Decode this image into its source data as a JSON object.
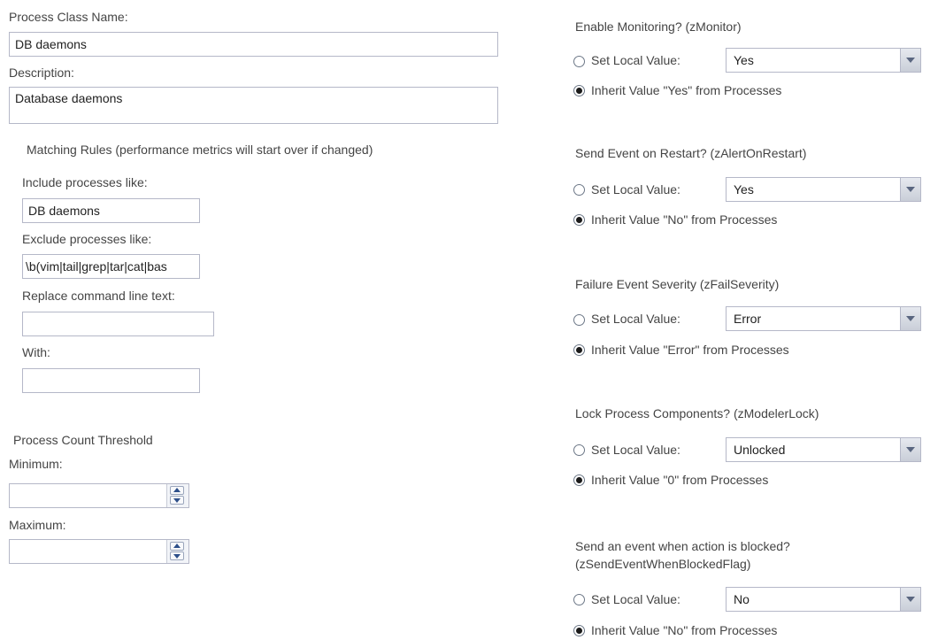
{
  "left": {
    "class_name_label": "Process Class Name:",
    "class_name_value": "DB daemons",
    "description_label": "Description:",
    "description_value": "Database daemons",
    "matching_header": "Matching Rules (performance metrics will start over if changed)",
    "include_label": "Include processes like:",
    "include_value": "DB daemons",
    "exclude_label": "Exclude processes like:",
    "exclude_value": "\\b(vim|tail|grep|tar|cat|bas",
    "replace_label": "Replace command line text:",
    "replace_value": "",
    "with_label": "With:",
    "with_value": "",
    "threshold_header": "Process Count Threshold",
    "minimum_label": "Minimum:",
    "minimum_value": "",
    "maximum_label": "Maximum:",
    "maximum_value": ""
  },
  "right": {
    "set_local_label": "Set Local Value:",
    "sections": [
      {
        "title": "Enable Monitoring? (zMonitor)",
        "local_value": "Yes",
        "inherit_text": "Inherit Value \"Yes\" from Processes",
        "mode": "inherit"
      },
      {
        "title": "Send Event on Restart? (zAlertOnRestart)",
        "local_value": "Yes",
        "inherit_text": "Inherit Value \"No\" from Processes",
        "mode": "inherit"
      },
      {
        "title": "Failure Event Severity (zFailSeverity)",
        "local_value": "Error",
        "inherit_text": "Inherit Value \"Error\" from Processes",
        "mode": "inherit"
      },
      {
        "title": "Lock Process Components? (zModelerLock)",
        "local_value": "Unlocked",
        "inherit_text": "Inherit Value \"0\" from Processes",
        "mode": "inherit"
      },
      {
        "title": "Send an event when action is blocked?",
        "title_line2": "(zSendEventWhenBlockedFlag)",
        "local_value": "No",
        "inherit_text": "Inherit Value \"No\" from Processes",
        "mode": "inherit"
      }
    ]
  }
}
